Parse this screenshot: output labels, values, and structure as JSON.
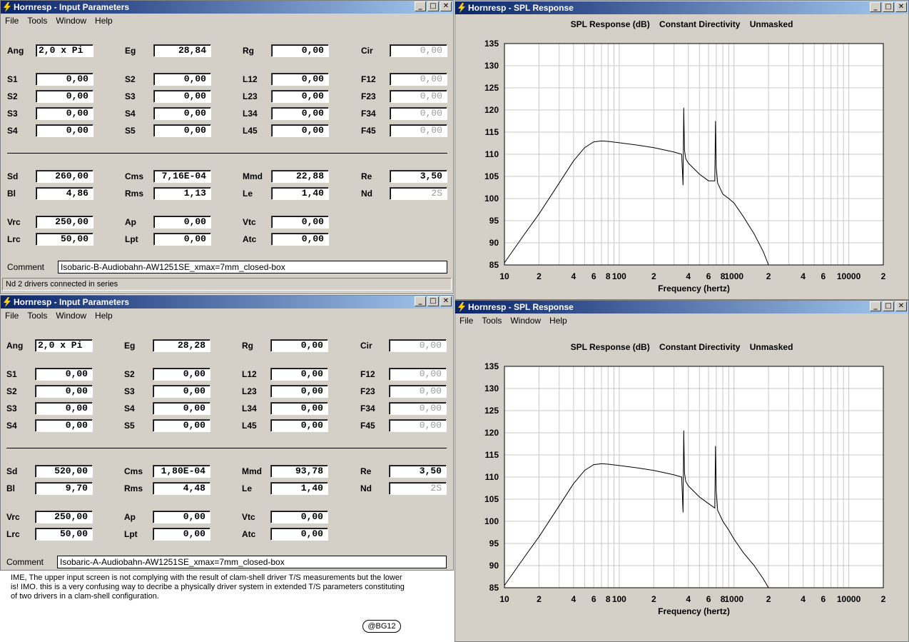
{
  "colors": {
    "titlebar_start": "#0a246a",
    "titlebar_end": "#a6caf0",
    "window_bg": "#d4d0c8"
  },
  "icons": {
    "window_logo": "lightning-bolt-icon",
    "minimize": "minimize-icon",
    "maximize": "maximize-icon",
    "close": "close-icon"
  },
  "input_top": {
    "title": "Hornresp - Input Parameters",
    "menu": [
      "File",
      "Tools",
      "Window",
      "Help"
    ],
    "params": {
      "Ang": "2,0 x Pi",
      "Eg": "28,84",
      "Rg": "0,00",
      "Cir": "0,00",
      "S1": "0,00",
      "S2a": "0,00",
      "L12": "0,00",
      "F12": "0,00",
      "S2": "0,00",
      "S3a": "0,00",
      "L23": "0,00",
      "F23": "0,00",
      "S3": "0,00",
      "S4a": "0,00",
      "L34": "0,00",
      "F34": "0,00",
      "S4": "0,00",
      "S5": "0,00",
      "L45": "0,00",
      "F45": "0,00",
      "Sd": "260,00",
      "Cms": "7,16E-04",
      "Mmd": "22,88",
      "Re": "3,50",
      "Bl": "4,86",
      "Rms": "1,13",
      "Le": "1,40",
      "Nd": "2S",
      "Vrc": "250,00",
      "Ap": "0,00",
      "Vtc": "0,00",
      "Lrc": "50,00",
      "Lpt": "0,00",
      "Atc": "0,00"
    },
    "comment_label": "Comment",
    "comment": "Isobaric-B-Audiobahn-AW1251SE_xmax=7mm_closed-box",
    "status": "Nd   2 drivers connected in series"
  },
  "input_bottom": {
    "title": "Hornresp - Input Parameters",
    "menu": [
      "File",
      "Tools",
      "Window",
      "Help"
    ],
    "params": {
      "Ang": "2,0 x Pi",
      "Eg": "28,28",
      "Rg": "0,00",
      "Cir": "0,00",
      "S1": "0,00",
      "S2a": "0,00",
      "L12": "0,00",
      "F12": "0,00",
      "S2": "0,00",
      "S3a": "0,00",
      "L23": "0,00",
      "F23": "0,00",
      "S3": "0,00",
      "S4a": "0,00",
      "L34": "0,00",
      "F34": "0,00",
      "S4": "0,00",
      "S5": "0,00",
      "L45": "0,00",
      "F45": "0,00",
      "Sd": "520,00",
      "Cms": "1,80E-04",
      "Mmd": "93,78",
      "Re": "3,50",
      "Bl": "9,70",
      "Rms": "4,48",
      "Le": "1,40",
      "Nd": "2S",
      "Vrc": "250,00",
      "Ap": "0,00",
      "Vtc": "0,00",
      "Lrc": "50,00",
      "Lpt": "0,00",
      "Atc": "0,00"
    },
    "comment_label": "Comment",
    "comment": "Isobaric-A-Audiobahn-AW1251SE_xmax=7mm_closed-box"
  },
  "spl_top": {
    "title": "Hornresp - SPL Response",
    "chart_title": "SPL Response (dB)    Constant Directivity    Unmasked",
    "xlabel": "Frequency (hertz)"
  },
  "spl_bottom": {
    "title": "Hornresp - SPL Response",
    "menu": [
      "File",
      "Tools",
      "Window",
      "Help"
    ],
    "chart_title": "SPL Response (dB)    Constant Directivity    Unmasked",
    "xlabel": "Frequency (hertz)"
  },
  "note": "IME, The upper input screen is not complying with the result of clam-shell driver T/S measurements but the lower is! IMO. this is a very confusing way to decribe a physically driver system in extended T/S parameters constituting of two drivers  in a clam-shell configuration.",
  "badge": "@BG12",
  "chart_data": [
    {
      "type": "line",
      "title": "SPL Response (dB)    Constant Directivity    Unmasked",
      "xlabel": "Frequency (hertz)",
      "ylabel": "",
      "xscale": "log",
      "xlim": [
        10,
        20000
      ],
      "ylim": [
        85,
        135
      ],
      "grid": true,
      "y_ticks": [
        "135",
        "130",
        "125",
        "120",
        "115",
        "110",
        "105",
        "100",
        "95",
        "90",
        "85"
      ],
      "x_ticks": [
        "10",
        "2",
        "4",
        "6",
        "8",
        "100",
        "2",
        "4",
        "6",
        "8",
        "1000",
        "2",
        "4",
        "6",
        "10000",
        "2"
      ],
      "series": [
        {
          "x": [
            10,
            15,
            20,
            30,
            40,
            50,
            60,
            70,
            80,
            100,
            150,
            200,
            300,
            350,
            360,
            365,
            370,
            380,
            400,
            500,
            600,
            680,
            690,
            700,
            720,
            800,
            900,
            1000,
            1200,
            1500,
            1800,
            2000
          ],
          "y": [
            85.5,
            92,
            96.5,
            103.5,
            108.5,
            111.5,
            112.8,
            113,
            112.9,
            112.6,
            112,
            111.5,
            110.5,
            110,
            103,
            120.5,
            111,
            109,
            108,
            105.5,
            104,
            104,
            117.5,
            107,
            103.5,
            101,
            100,
            99,
            96,
            92,
            88,
            85
          ]
        }
      ]
    },
    {
      "type": "line",
      "title": "SPL Response (dB)    Constant Directivity    Unmasked",
      "xlabel": "Frequency (hertz)",
      "ylabel": "",
      "xscale": "log",
      "xlim": [
        10,
        20000
      ],
      "ylim": [
        85,
        135
      ],
      "grid": true,
      "y_ticks": [
        "135",
        "130",
        "125",
        "120",
        "115",
        "110",
        "105",
        "100",
        "95",
        "90",
        "85"
      ],
      "x_ticks": [
        "10",
        "2",
        "4",
        "6",
        "8",
        "100",
        "2",
        "4",
        "6",
        "8",
        "1000",
        "2",
        "4",
        "6",
        "10000",
        "2"
      ],
      "series": [
        {
          "x": [
            10,
            15,
            20,
            30,
            40,
            50,
            60,
            70,
            80,
            100,
            150,
            200,
            300,
            350,
            360,
            365,
            370,
            380,
            400,
            500,
            600,
            680,
            690,
            700,
            720,
            800,
            900,
            1000,
            1200,
            1500,
            1800,
            2000
          ],
          "y": [
            85.5,
            92,
            96.5,
            103.5,
            108.5,
            111.5,
            112.8,
            113,
            112.9,
            112.6,
            112,
            111.5,
            110.5,
            110,
            102,
            120.5,
            111,
            109,
            108,
            105.5,
            104,
            103,
            117,
            107,
            102.5,
            100,
            98,
            96,
            93,
            90,
            87,
            85
          ]
        }
      ]
    }
  ]
}
